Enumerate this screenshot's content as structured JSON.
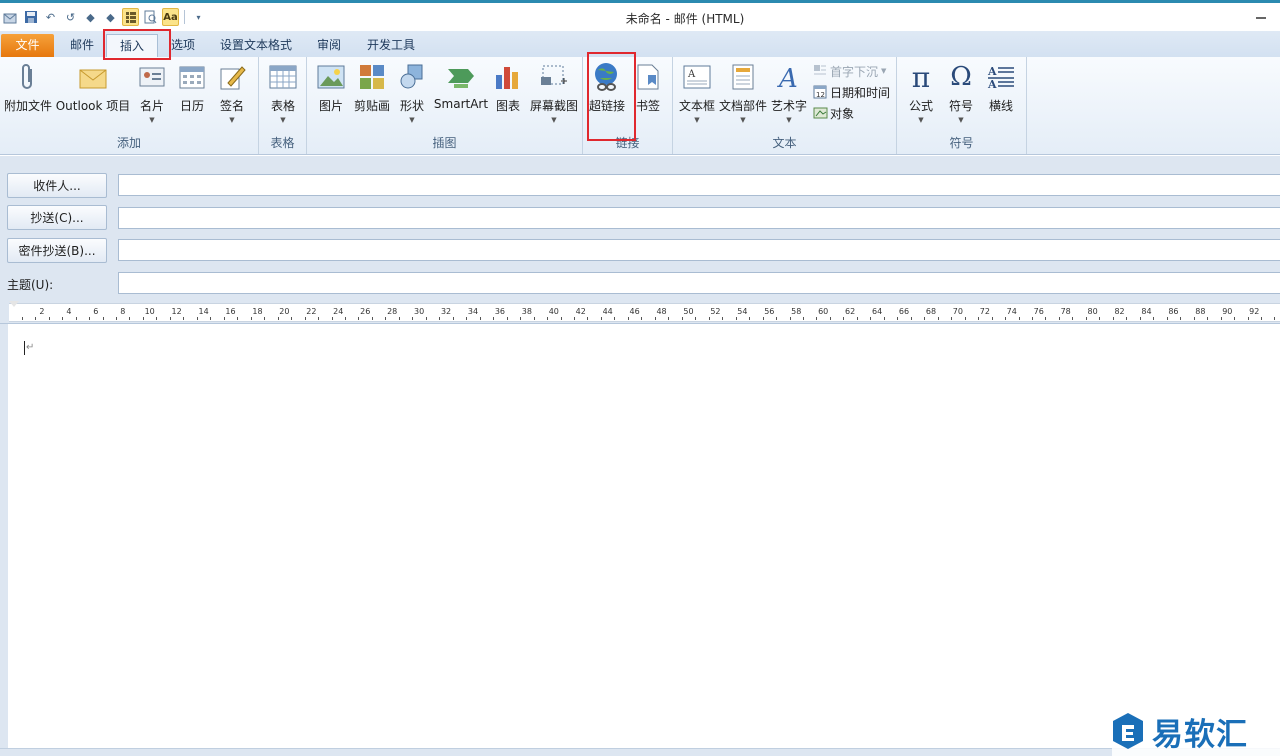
{
  "window": {
    "title": "未命名 - 邮件 (HTML)"
  },
  "quick_access": [
    {
      "icon": "send-receive-icon"
    },
    {
      "icon": "save-icon"
    },
    {
      "icon": "undo-icon"
    },
    {
      "icon": "redo-icon"
    },
    {
      "icon": "up-arrow-icon"
    },
    {
      "icon": "down-arrow-icon"
    },
    {
      "icon": "format-list-icon"
    },
    {
      "icon": "print-preview-icon"
    },
    {
      "icon": "font-aa-icon"
    }
  ],
  "tabs": [
    {
      "label": "文件"
    },
    {
      "label": "邮件"
    },
    {
      "label": "插入"
    },
    {
      "label": "选项"
    },
    {
      "label": "设置文本格式"
    },
    {
      "label": "审阅"
    },
    {
      "label": "开发工具"
    }
  ],
  "ribbon": {
    "add_group": {
      "label": "添加",
      "attach_file": "附加文件",
      "outlook_item": "Outlook 项目",
      "business_card": "名片",
      "calendar": "日历",
      "signature": "签名"
    },
    "table_group": {
      "label": "表格",
      "table": "表格"
    },
    "illustrations_group": {
      "label": "插图",
      "picture": "图片",
      "clipart": "剪贴画",
      "shapes": "形状",
      "smartart": "SmartArt",
      "chart": "图表",
      "screenshot": "屏幕截图"
    },
    "links_group": {
      "label": "链接",
      "hyperlink": "超链接",
      "bookmark": "书签"
    },
    "text_group": {
      "label": "文本",
      "textbox": "文本框",
      "quick_parts": "文档部件",
      "wordart": "艺术字",
      "drop_cap": "首字下沉",
      "date_time": "日期和时间",
      "object": "对象"
    },
    "symbols_group": {
      "label": "符号",
      "equation": "公式",
      "symbol": "符号",
      "horizontal_line": "横线"
    }
  },
  "fields": {
    "to": "收件人...",
    "cc": "抄送(C)...",
    "bcc": "密件抄送(B)...",
    "subject": "主题(U):"
  },
  "ruler": {
    "marks": [
      2,
      4,
      6,
      8,
      10,
      12,
      14,
      16,
      18,
      20,
      22,
      24,
      26,
      28,
      30,
      32,
      34,
      36,
      38,
      40,
      42,
      44,
      46,
      48,
      50,
      52,
      54,
      56,
      58,
      60,
      62,
      64,
      66,
      68,
      70,
      72,
      74,
      76,
      78,
      80,
      82,
      84,
      86,
      88,
      90,
      92
    ]
  },
  "watermark": {
    "text": "易软汇"
  }
}
